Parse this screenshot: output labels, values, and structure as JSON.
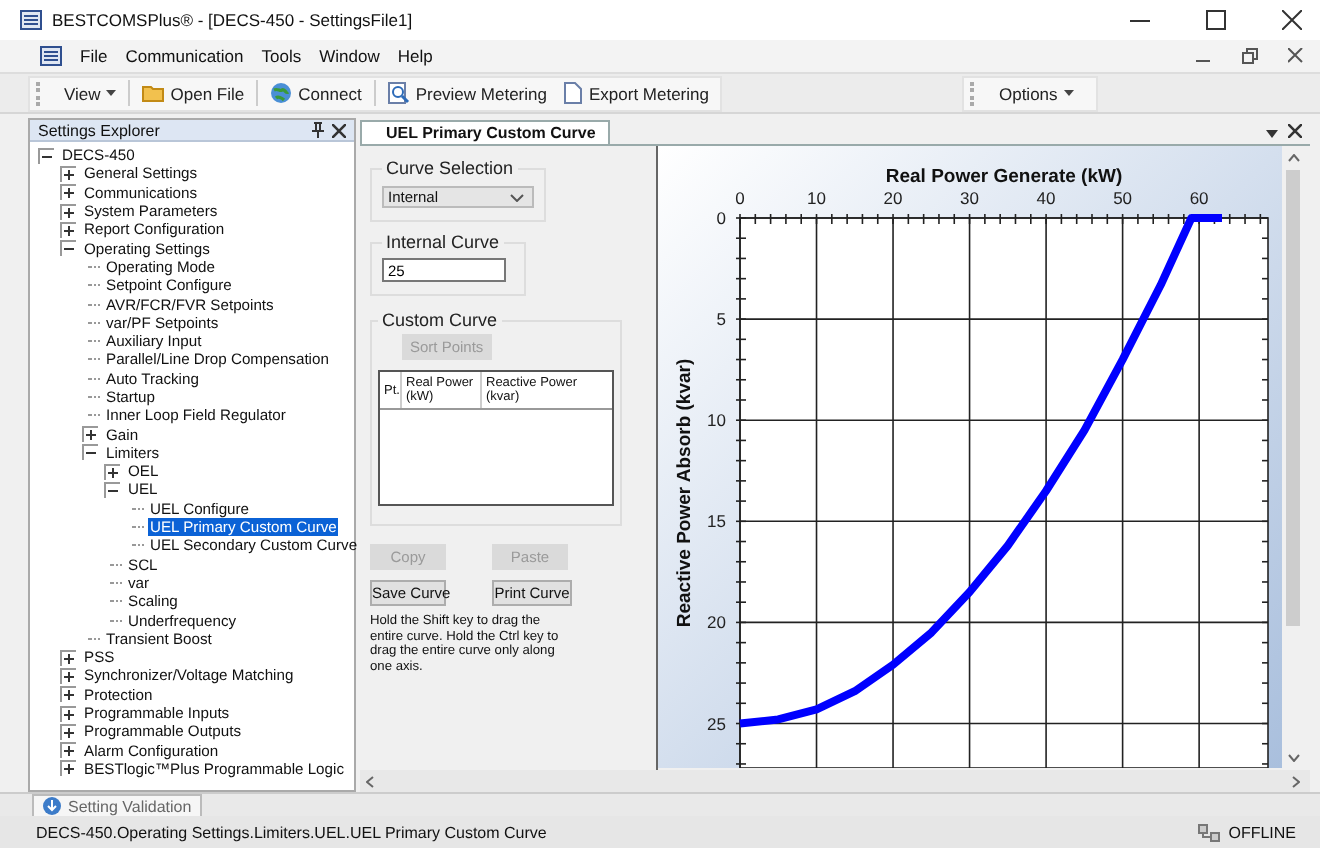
{
  "window": {
    "title": "BESTCOMSPlus® - [DECS-450 - SettingsFile1]"
  },
  "menu": [
    "File",
    "Communication",
    "Tools",
    "Window",
    "Help"
  ],
  "toolbar": {
    "view_menu": "View",
    "buttons": [
      "Open File",
      "Connect",
      "Preview Metering",
      "Export Metering"
    ],
    "options_menu": "Options"
  },
  "explorer": {
    "title": "Settings Explorer",
    "tree": [
      {
        "label": "DECS-450",
        "selected": false,
        "expanded": true,
        "children": [
          {
            "label": "General Settings",
            "selected": false,
            "expanded": false
          },
          {
            "label": "Communications",
            "selected": false,
            "expanded": false
          },
          {
            "label": "System Parameters",
            "selected": false,
            "expanded": false
          },
          {
            "label": "Report Configuration",
            "selected": false,
            "expanded": false
          },
          {
            "label": "Operating Settings",
            "selected": false,
            "expanded": true,
            "children": [
              {
                "label": "Operating Mode",
                "selected": false
              },
              {
                "label": "Setpoint Configure",
                "selected": false
              },
              {
                "label": "AVR/FCR/FVR Setpoints",
                "selected": false
              },
              {
                "label": "var/PF Setpoints",
                "selected": false
              },
              {
                "label": "Auxiliary Input",
                "selected": false
              },
              {
                "label": "Parallel/Line Drop Compensation",
                "selected": false
              },
              {
                "label": "Auto Tracking",
                "selected": false
              },
              {
                "label": "Startup",
                "selected": false
              },
              {
                "label": "Inner Loop Field Regulator",
                "selected": false
              },
              {
                "label": "Gain",
                "selected": false,
                "expanded": false
              },
              {
                "label": "Limiters",
                "selected": false,
                "expanded": true,
                "children": [
                  {
                    "label": "OEL",
                    "selected": false,
                    "expanded": false
                  },
                  {
                    "label": "UEL",
                    "selected": false,
                    "expanded": true,
                    "children": [
                      {
                        "label": "UEL Configure",
                        "selected": false
                      },
                      {
                        "label": "UEL Primary Custom Curve",
                        "selected": true
                      },
                      {
                        "label": "UEL Secondary Custom Curve",
                        "selected": false
                      }
                    ]
                  },
                  {
                    "label": "SCL",
                    "selected": false
                  },
                  {
                    "label": "var",
                    "selected": false
                  },
                  {
                    "label": "Scaling",
                    "selected": false
                  },
                  {
                    "label": "Underfrequency",
                    "selected": false
                  }
                ]
              },
              {
                "label": "Transient Boost",
                "selected": false
              }
            ]
          },
          {
            "label": "PSS",
            "selected": false,
            "expanded": false
          },
          {
            "label": "Synchronizer/Voltage Matching",
            "selected": false,
            "expanded": false
          },
          {
            "label": "Protection",
            "selected": false,
            "expanded": false
          },
          {
            "label": "Programmable Inputs",
            "selected": false,
            "expanded": false
          },
          {
            "label": "Programmable Outputs",
            "selected": false,
            "expanded": false
          },
          {
            "label": "Alarm Configuration",
            "selected": false,
            "expanded": false
          },
          {
            "label": "BESTlogic™Plus Programmable Logic",
            "selected": false,
            "expanded": false
          }
        ]
      }
    ]
  },
  "editor": {
    "tab": "UEL Primary Custom Curve",
    "curve_selection": {
      "label": "Curve Selection",
      "value": "Internal"
    },
    "internal_curve": {
      "label": "Internal Curve",
      "value": "25"
    },
    "custom_curve": {
      "label": "Custom Curve",
      "sort_button": {
        "label": "Sort Points",
        "disabled": true
      },
      "columns": [
        "Pt.",
        "Real Power (kW)",
        "Reactive Power (kvar)"
      ]
    },
    "buttons": [
      {
        "label": "Copy",
        "disabled": true
      },
      {
        "label": "Paste",
        "disabled": true
      },
      {
        "label": "Save Curve",
        "disabled": false
      },
      {
        "label": "Print Curve",
        "disabled": false
      }
    ],
    "hint": "Hold the Shift key to drag the entire curve.  Hold the Ctrl key to drag the entire curve only along one axis.",
    "chart_data": {
      "type": "line",
      "xlabel": "Real Power Generate (kW)",
      "ylabel": "Reactive Power Absorb (kvar)",
      "xlim": [
        0,
        69
      ],
      "ylim": [
        27.2,
        0
      ],
      "grid": true,
      "xticks": [
        0,
        10,
        20,
        30,
        40,
        50,
        60
      ],
      "yticks": [
        0,
        5,
        10,
        15,
        20,
        25
      ],
      "series": [
        {
          "color": "#0000ff",
          "x": [
            0,
            5,
            10,
            15,
            20,
            25,
            30,
            35,
            40,
            45,
            50,
            55,
            59,
            63
          ],
          "values": [
            25,
            24.8,
            24.3,
            23.4,
            22.1,
            20.5,
            18.5,
            16.2,
            13.5,
            10.5,
            7,
            3.3,
            0,
            0
          ]
        }
      ]
    }
  },
  "bottom_tab": "Setting Validation",
  "status_bar": {
    "path": "DECS-450.Operating Settings.Limiters.UEL.UEL Primary Custom Curve",
    "connection": "OFFLINE"
  }
}
